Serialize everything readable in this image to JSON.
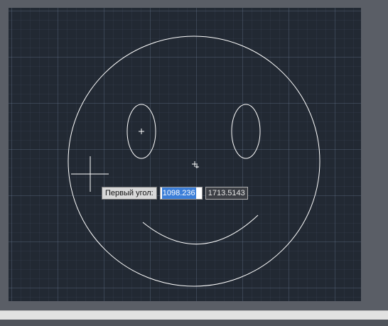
{
  "prompt": {
    "label": "Первый угол:",
    "x_value": "1098.236",
    "y_value": "1713.5143"
  },
  "drawing": {
    "description_icons": [
      "crosshair-cursor-icon",
      "pickbox-icon"
    ],
    "colors": {
      "background": "#222933",
      "geometry": "#ffffff",
      "selection": "#3b7ed8"
    }
  }
}
